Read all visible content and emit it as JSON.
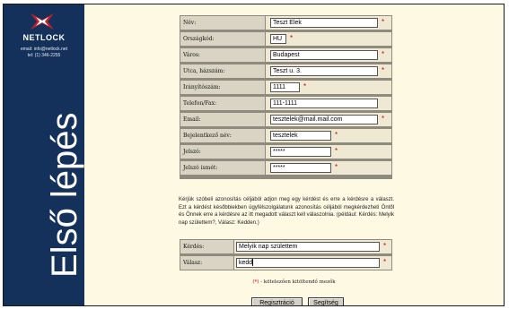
{
  "sidebar": {
    "brand": "NETLOCK",
    "email": "email: info@netlock.net",
    "phone": "tel: (1) 346-2255",
    "vertical_title": "Első lépés"
  },
  "form": {
    "fields": [
      {
        "label": "Név:",
        "value": "Teszt Elek"
      },
      {
        "label": "Országkód:",
        "value": "HU"
      },
      {
        "label": "Város:",
        "value": "Budapest"
      },
      {
        "label": "Utca, házszám:",
        "value": "Teszt u. 3."
      },
      {
        "label": "Irányítószám:",
        "value": "1111"
      },
      {
        "label": "Telefon/Fax:",
        "value": "111-1111"
      },
      {
        "label": "Email:",
        "value": "tesztelek@mail.mail.com"
      },
      {
        "label": "Bejelentkező név:",
        "value": "tesztelek"
      },
      {
        "label": "Jelszó:",
        "value": "*****"
      },
      {
        "label": "Jelszó ismét:",
        "value": "*****"
      }
    ],
    "required_mark": "*"
  },
  "instructions": "Kérjük szóbeli azonosítás céljából adjon meg egy kérdést és erre a kérdésre a választ. Ezt a kérdést későbbiekben ügyfélszolgálatunk azonosítás céljából megkérdezheti Öntől és Önnek erre a kérdésre az itt megadott választ kell válaszolnia. (például: Kérdés: Melyik nap születtem?, Válasz: Kedden.)",
  "security": {
    "question_label": "Kérdés:",
    "question_value": "Melyik nap születtem",
    "answer_label": "Válasz:",
    "answer_value": "kedd"
  },
  "footnote": {
    "mark": "(*)",
    "text": " - kötelezően kitöltendő mezők"
  },
  "buttons": {
    "register": "Regisztráció",
    "help": "Segítség"
  },
  "colors": {
    "sidebar_bg": "#13315a",
    "page_bg": "#fdf9e3",
    "label_bg": "#d9d4c3",
    "required": "#cc0000"
  }
}
